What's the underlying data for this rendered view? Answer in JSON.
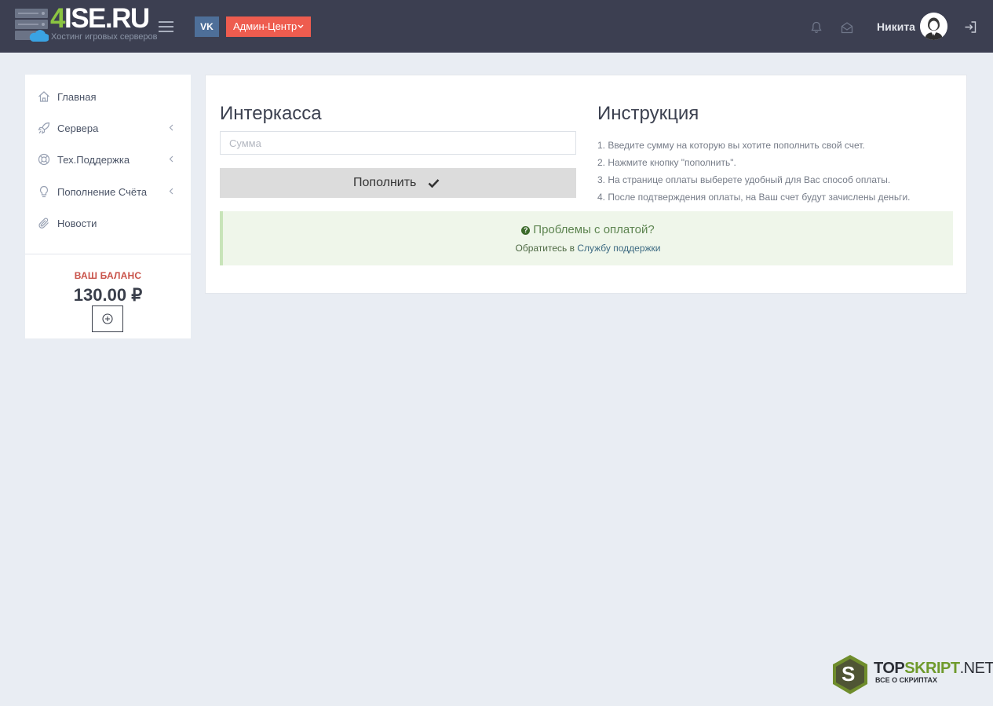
{
  "header": {
    "logo": {
      "brand_prefix": "4",
      "brand_rest": "ISE.RU",
      "tagline": "Хостинг игровых серверов"
    },
    "vk_label": "VK",
    "admin_label": "Админ-Центр",
    "user_name": "Никита",
    "colors": {
      "background": "#3c3f51",
      "admin_button": "#ee5c4f",
      "vk_button": "#4e6f99",
      "logo_accent": "#8bc541"
    }
  },
  "sidebar": {
    "items": [
      {
        "label": "Главная",
        "icon": "home-icon",
        "has_submenu": false
      },
      {
        "label": "Сервера",
        "icon": "rocket-icon",
        "has_submenu": true
      },
      {
        "label": "Тех.Поддержка",
        "icon": "lifebuoy-icon",
        "has_submenu": true
      },
      {
        "label": "Пополнение Счёта",
        "icon": "lightbulb-icon",
        "has_submenu": true
      },
      {
        "label": "Новости",
        "icon": "paperclip-icon",
        "has_submenu": false
      }
    ],
    "balance": {
      "label": "ВАШ БАЛАНС",
      "value": "130.00 ₽"
    }
  },
  "main": {
    "form": {
      "title": "Интеркасса",
      "amount_placeholder": "Сумма",
      "amount_value": "",
      "submit_label": "Пополнить"
    },
    "instructions": {
      "title": "Инструкция",
      "steps": [
        "1. Введите сумму на которую вы хотите пополнить свой счет.",
        "2. Нажмите кнопку \"пополнить\".",
        "3. На странице оплаты выберете удобный для Вас способ оплаты.",
        "4. После подтверждения оплаты, на Ваш счет будут зачислены деньги."
      ]
    },
    "alert": {
      "title": "Проблемы с оплатой?",
      "text_prefix": "Обратитесь в",
      "link_label": "Службу поддержки"
    }
  },
  "watermark": {
    "letter": "S",
    "name_a": "TOP",
    "name_b": "SKRIPT",
    "name_c": ".NET",
    "tagline": "ВСЕ О СКРИПТАХ"
  }
}
